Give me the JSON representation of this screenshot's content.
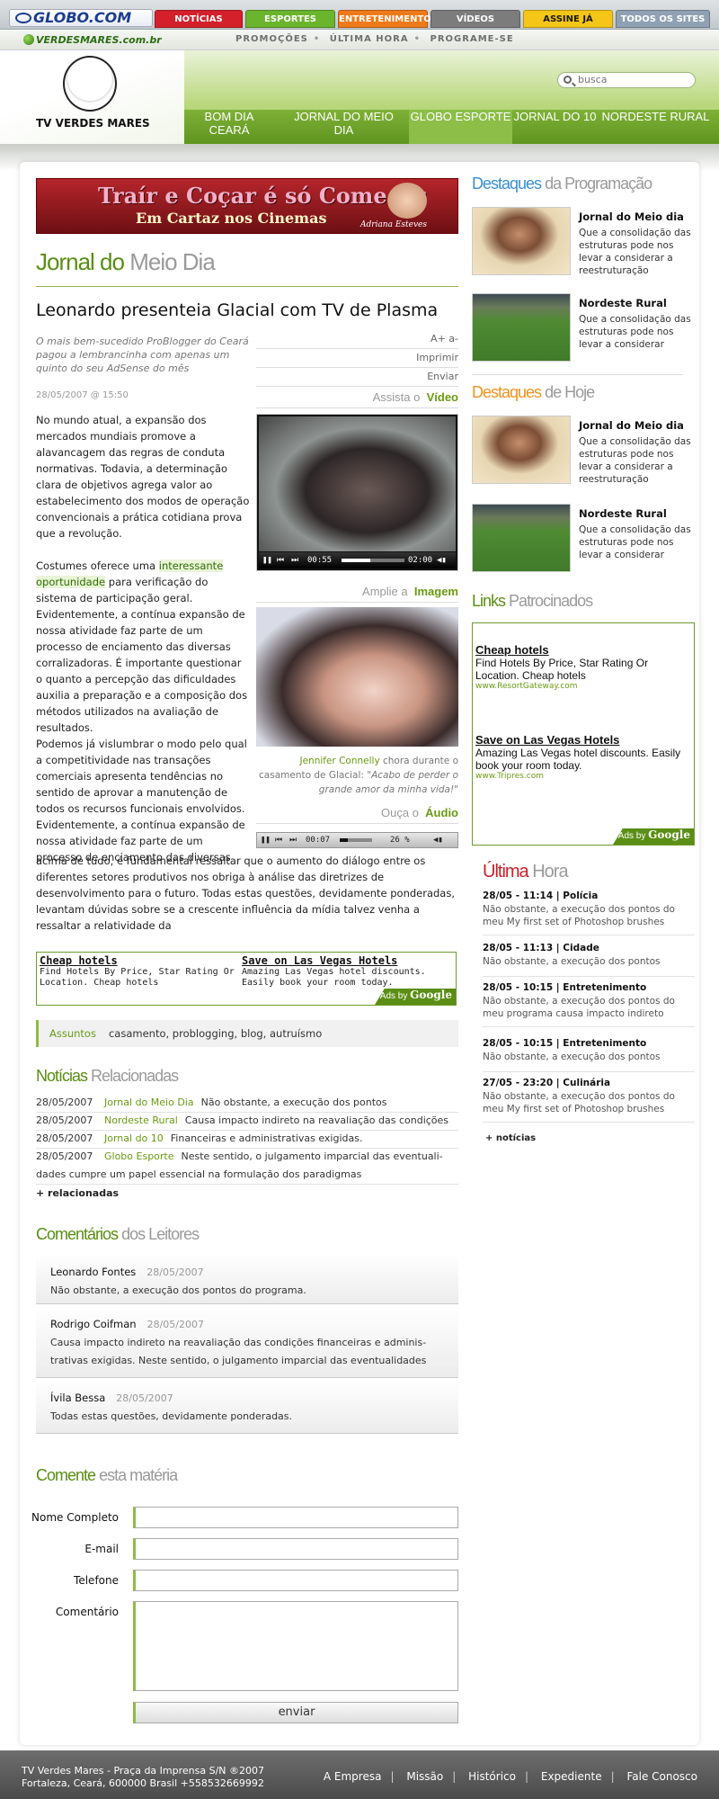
{
  "globo_bar": {
    "logo": "GLOBO.COM",
    "tabs": [
      {
        "label": "NOTÍCIAS",
        "color": "#d3202b"
      },
      {
        "label": "ESPORTES",
        "color": "#6ab52c"
      },
      {
        "label": "ENTRETENIMENTO",
        "color": "#ef7a1a"
      },
      {
        "label": "VÍDEOS",
        "color": "#7c7c7c"
      },
      {
        "label": "ASSINE JÁ",
        "color": "#f5c518"
      },
      {
        "label": "TODOS OS SITES",
        "color": "#8fa1b3"
      }
    ]
  },
  "sub_bar": {
    "site": "VERDESMARES.com.br",
    "links": [
      "PROMOÇÕES",
      "ÚLTIMA HORA",
      "PROGRAME-SE"
    ]
  },
  "header": {
    "logo_text": "TV VERDES MARES",
    "search_placeholder": "busca",
    "nav": [
      "BOM DIA CEARÁ",
      "JORNAL DO MEIO DIA",
      "GLOBO ESPORTE",
      "JORNAL DO 10",
      "NORDESTE RURAL"
    ],
    "nav_active": "GLOBO ESPORTE"
  },
  "banner": {
    "title": "Traír e Coçar é só Começar",
    "subtitle": "Em Cartaz nos Cinemas",
    "name": "Adriana Esteves"
  },
  "section": {
    "title_a": "Jornal do",
    "title_b": "Meio Dia"
  },
  "article": {
    "headline": "Leonardo presenteia Glacial com TV de Plasma",
    "summary": "O mais bem-sucedido ProBlogger do Ceará pagou a lembrancinha com apenas um quinto do seu AdSense do mês",
    "date": "28/05/2007 @ 15:50",
    "tools": [
      "A+ a-",
      "Imprimir",
      "Enviar"
    ],
    "p1": "No mundo atual, a expansão dos mercados mundiais promove a alavancagem das regras de conduta normativas. Todavia, a determinação clara de objetivos agrega valor ao estabelecimento dos modos de operação convencionais a prática cotidiana prova que a revolução.",
    "p2_a": "Costumes oferece uma ",
    "p2_link": "interessante oportunidade",
    "p2_b": " para verificação do sistema de participação geral. Evidentemente, a contínua expansão de nossa atividade faz parte de um processo de enciamento das diversas corralizadoras. É importante questionar o quanto a percepção das dificuldades auxilia a preparação e a composição dos métodos utilizados na avaliação de resultados.",
    "p3": "Podemos já vislumbrar o modo pelo qual a competitividade nas transações comerciais apresenta tendências no sentido de aprovar a manutenção de todos os recursos funcionais envolvidos. Evidentemente, a contínua expansão de nossa atividade faz parte de um processo de enciamento das diversas",
    "p3_full": "acima de tudo, é fundamental ressaltar que o aumento do diálogo entre os diferentes setores produtivos nos obriga à análise das diretrizes de desenvolvimento para o futuro. Todas estas questões, devidamente ponderadas, levantam dúvidas sobre se a crescente influência da mídia talvez venha a ressaltar a relatividade da"
  },
  "media": {
    "video_label_a": "Assista o",
    "video_label_b": "Vídeo",
    "video_time": "00:55",
    "video_total": "02:00",
    "video_progress": 0.46,
    "photo_label_a": "Amplie a",
    "photo_label_b": "Imagem",
    "caption_name": "Jennifer Connelly",
    "caption_text": " chora durante o casamento de Glacial: ",
    "caption_quote": "\"Acabo de perder o grande amor da minha vida!\"",
    "audio_label_a": "Ouça o",
    "audio_label_b": "Áudio",
    "audio_time": "00:07",
    "audio_percent": "26 %",
    "audio_progress": 0.26
  },
  "inline_ads": [
    {
      "title": "Cheap hotels",
      "text": "Find Hotels By Price, Star Rating Or Location. Cheap hotels"
    },
    {
      "title": "Save on Las Vegas Hotels",
      "text": "Amazing Las Vegas hotel discounts. Easily book your room today."
    }
  ],
  "ads_by": "Ads by",
  "ads_brand": "Google",
  "assuntos": {
    "label": "Assuntos",
    "tags": "casamento, problogging, blog, autruísmo"
  },
  "related": {
    "title_a": "Notícias",
    "title_b": "Relacionadas",
    "items": [
      {
        "date": "28/05/2007",
        "section": "Jornal do Meio Dia",
        "text": "Não obstante, a execução dos pontos"
      },
      {
        "date": "28/05/2007",
        "section": "Nordeste Rural",
        "text": "Causa impacto indireto na reavaliação das condições"
      },
      {
        "date": "28/05/2007",
        "section": "Jornal do 10",
        "text": "Financeiras e administrativas exigidas."
      },
      {
        "date": "28/05/2007",
        "section": "Globo Esporte",
        "text": "Neste sentido, o julgamento imparcial das eventuali-",
        "text2": "dades cumpre um papel essencial na formulação dos paradigmas"
      }
    ],
    "more": "+ relacionadas"
  },
  "comments": {
    "title_a": "Comentários",
    "title_b": "dos Leitores",
    "items": [
      {
        "name": "Leonardo Fontes",
        "date": "28/05/2007",
        "text": "Não obstante, a execução dos pontos do programa."
      },
      {
        "name": "Rodrigo Coifman",
        "date": "28/05/2007",
        "text": "Causa impacto indireto na reavaliação das condições financeiras e adminis-",
        "text2": "trativas exigidas. Neste sentido, o julgamento imparcial das eventualidades"
      },
      {
        "name": "Ívila Bessa",
        "date": "28/05/2007",
        "text": "Todas estas questões, devidamente ponderadas."
      }
    ]
  },
  "form": {
    "title_a": "Comente",
    "title_b": "esta matéria",
    "labels": [
      "Nome Completo",
      "E-mail",
      "Telefone",
      "Comentário"
    ],
    "submit": "enviar"
  },
  "sidebar": {
    "destaques_prog": {
      "title_a": "Destaques",
      "title_b": "da Programação",
      "color": "#3a8fd1"
    },
    "destaques_hoje": {
      "title_a": "Destaques",
      "title_b": "de Hoje",
      "color": "#f0931e"
    },
    "items": [
      {
        "title": "Jornal do Meio dia",
        "text": "Que a consolidação das estruturas pode nos levar a considerar a reestruturação"
      },
      {
        "title": "Nordeste Rural",
        "text": "Que a consolidação das estruturas pode nos levar a considerar"
      }
    ],
    "links": {
      "title_a": "Links",
      "title_b": "Patrocinados",
      "ads": [
        {
          "title": "Cheap hotels",
          "text": "Find Hotels By Price, Star Rating Or Location. Cheap hotels",
          "url": "www.ResortGateway.com"
        },
        {
          "title": "Save on Las Vegas Hotels",
          "text": "Amazing Las Vegas hotel discounts. Easily book your room today.",
          "url": "www.Tripres.com"
        }
      ]
    },
    "ultima": {
      "title_a": "Última",
      "title_b": "Hora",
      "color": "#c9202a",
      "items": [
        {
          "head": "28/05 - 11:14 | Polícia",
          "text": "Não obstante, a execução dos pontos do meu My first set of Photoshop brushes"
        },
        {
          "head": "28/05 - 11:13 | Cidade",
          "text": "Não obstante, a execução dos pontos"
        },
        {
          "head": "28/05 - 10:15 | Entretenimento",
          "text": "Não obstante, a execução dos pontos do meu programa causa impacto indireto"
        },
        {
          "head": "28/05 - 10:15 | Entretenimento",
          "text": "Não obstante, a execução dos pontos"
        },
        {
          "head": "27/05 - 23:20 | Culinária",
          "text": "Não obstante, a execução dos pontos do meu My first set of Photoshop brushes"
        }
      ],
      "more": "+ notícias"
    }
  },
  "footer": {
    "line1": "TV Verdes Mares - Praça da Imprensa S/N  ®2007",
    "line2": "Fortaleza, Ceará, 600000 Brasil +558532669992",
    "links": [
      "A Empresa",
      "Missão",
      "Histórico",
      "Expediente",
      "Fale Conosco"
    ]
  }
}
